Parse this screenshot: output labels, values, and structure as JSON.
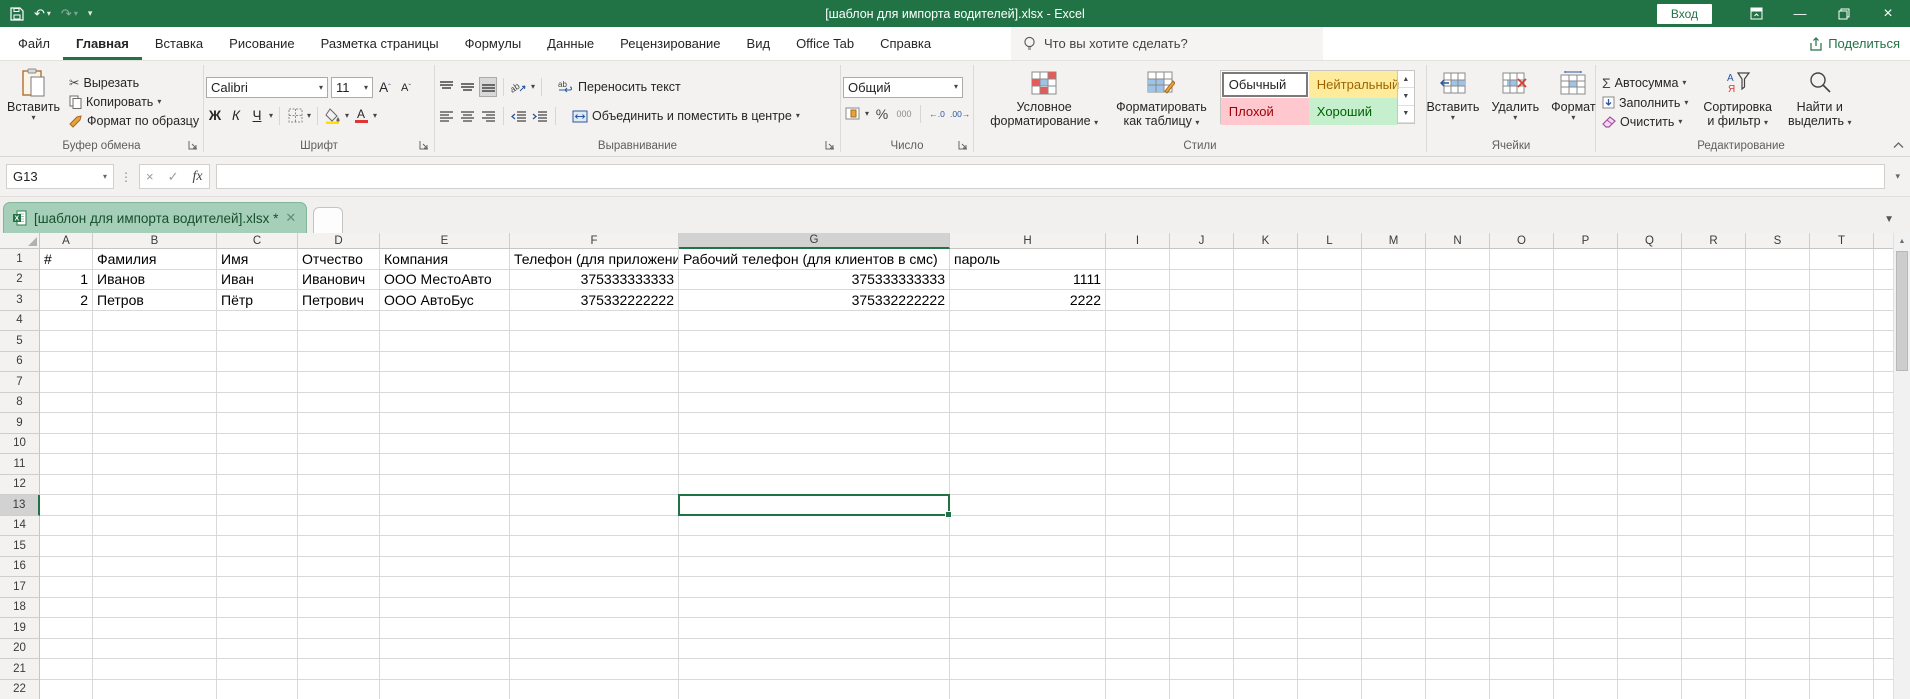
{
  "colors": {
    "accent": "#217346",
    "neutral_bg": "#FFEB9C",
    "neutral_text": "#9C6500",
    "bad_bg": "#FFC7CE",
    "bad_text": "#9C0006",
    "good_bg": "#C6EFCE",
    "good_text": "#006100"
  },
  "title_bar": {
    "title": "[шаблон для импорта водителей].xlsx  -  Excel",
    "signin": "Вход"
  },
  "tabs": {
    "file": "Файл",
    "home": "Главная",
    "insert": "Вставка",
    "draw": "Рисование",
    "layout": "Разметка страницы",
    "formulas": "Формулы",
    "data": "Данные",
    "review": "Рецензирование",
    "view": "Вид",
    "officetab": "Office Tab",
    "help": "Справка"
  },
  "search_placeholder": "Что вы хотите сделать?",
  "share": "Поделиться",
  "ribbon": {
    "clipboard": {
      "group": "Буфер обмена",
      "paste": "Вставить",
      "cut": "Вырезать",
      "copy": "Копировать",
      "painter": "Формат по образцу"
    },
    "font": {
      "group": "Шрифт",
      "name": "Calibri",
      "size": "11",
      "bold": "Ж",
      "italic": "К",
      "underline": "Ч",
      "grow": "A",
      "shrink": "A"
    },
    "align": {
      "group": "Выравнивание",
      "wrap": "Переносить текст",
      "merge": "Объединить и поместить в центре"
    },
    "number": {
      "group": "Число",
      "format": "Общий",
      "percent": "%",
      "thousands": "000",
      "inc_dec": "←.0",
      "dec_dec": ".00→"
    },
    "styles": {
      "group": "Стили",
      "cond1": "Условное",
      "cond2": "форматирование",
      "fmt1": "Форматировать",
      "fmt2": "как таблицу",
      "normal": "Обычный",
      "neutral": "Нейтральный",
      "bad": "Плохой",
      "good": "Хороший"
    },
    "cells": {
      "group": "Ячейки",
      "insert": "Вставить",
      "del": "Удалить",
      "format": "Формат"
    },
    "edit": {
      "group": "Редактирование",
      "autosum": "Автосумма",
      "fill": "Заполнить",
      "clear": "Очистить",
      "sort1": "Сортировка",
      "sort2": "и фильтр",
      "find1": "Найти и",
      "find2": "выделить"
    }
  },
  "formula_bar": {
    "name_box": "G13",
    "formula": "",
    "fx": "fx"
  },
  "doc_tab": {
    "label": "[шаблон для импорта водителей].xlsx *"
  },
  "sheet": {
    "selected_cell": "G13",
    "columns": [
      "A",
      "B",
      "C",
      "D",
      "E",
      "F",
      "G",
      "H",
      "I",
      "J",
      "K",
      "L",
      "M",
      "N",
      "O",
      "P",
      "Q",
      "R",
      "S",
      "T"
    ],
    "row_count": 22,
    "cells": [
      [
        "#",
        "Фамилия",
        "Имя",
        "Отчество",
        "Компания",
        "Телефон (для приложения)",
        "Рабочий телефон (для клиентов в смс)",
        "пароль"
      ],
      [
        "1",
        "Иванов",
        "Иван",
        "Иванович",
        "ООО МестоАвто",
        "375333333333",
        "375333333333",
        "1111"
      ],
      [
        "2",
        "Петров",
        "Пётр",
        "Петрович",
        "ООО АвтоБус",
        "375332222222",
        "375332222222",
        "2222"
      ]
    ]
  }
}
